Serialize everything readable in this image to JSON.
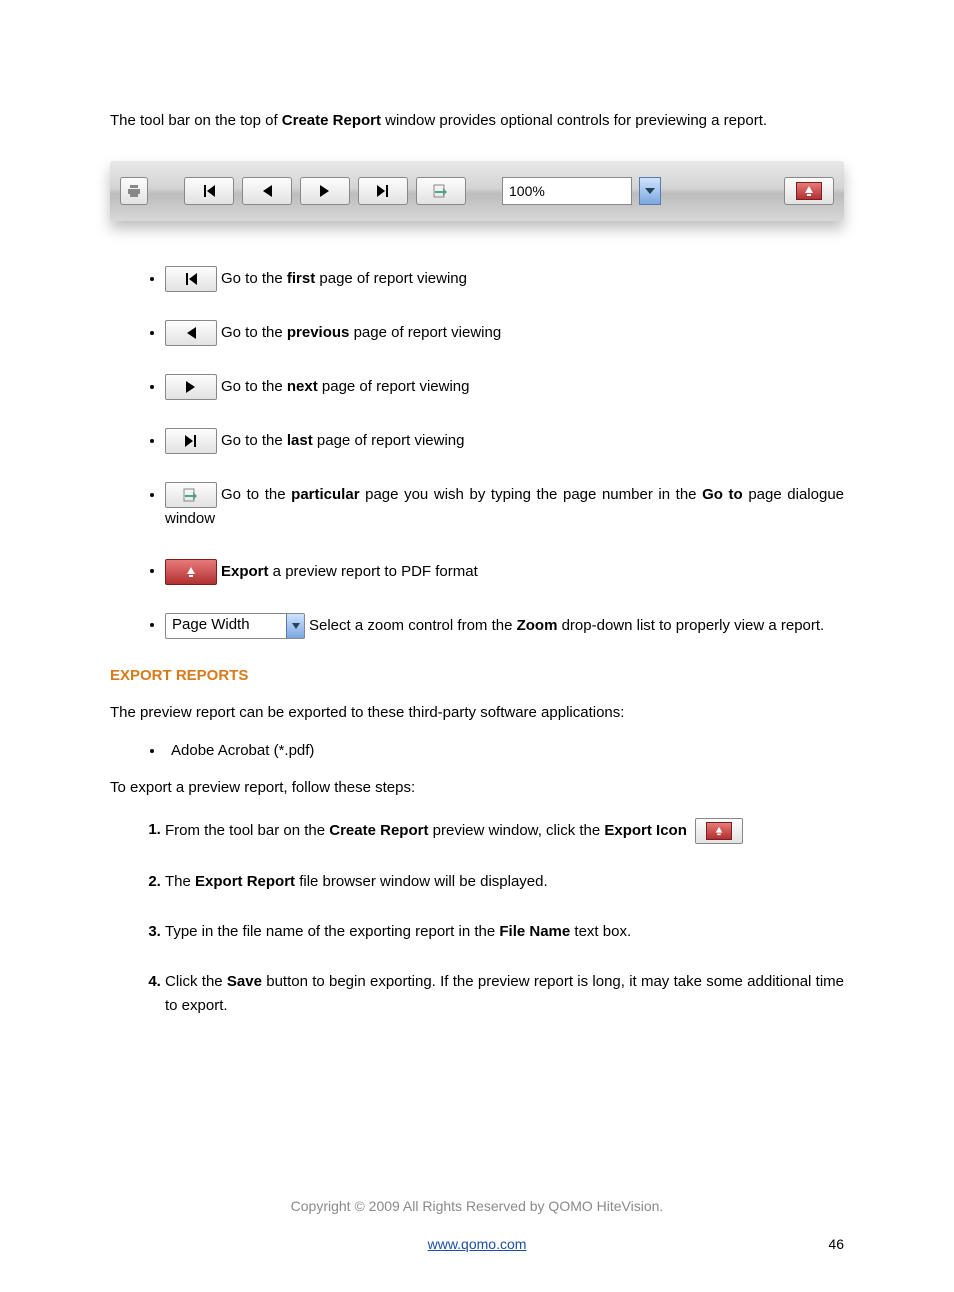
{
  "intro": {
    "pre": "The tool bar on the top of ",
    "bold": "Create Report",
    "post": " window provides optional controls for previewing a report."
  },
  "toolbar": {
    "zoom_value": "100%"
  },
  "bullets": {
    "first": {
      "a": "Go to the ",
      "b": "first",
      "c": " page of report viewing"
    },
    "prev": {
      "a": "Go to the ",
      "b": "previous",
      "c": " page of report viewing"
    },
    "next": {
      "a": "Go to the ",
      "b": "next",
      "c": " page of report viewing"
    },
    "last": {
      "a": "Go to the ",
      "b": "last",
      "c": " page of report viewing"
    },
    "goto": {
      "a": "Go to the ",
      "b": "particular",
      "c": " page you wish by typing the page number in the ",
      "d": "Go to",
      "e": " page dialogue window"
    },
    "export": {
      "b": "Export",
      "c": " a preview report to PDF format"
    },
    "zoom": {
      "label": "Page Width",
      "a": "Select a zoom control from the ",
      "b": "Zoom",
      "c": " drop-down list to properly view a report."
    }
  },
  "export_section": {
    "heading": "EXPORT REPORTS",
    "p1": "The preview report can be exported to these third-party software applications:",
    "list_item": "Adobe Acrobat (*.pdf)",
    "p2": "To export a preview report, follow these steps:",
    "steps": {
      "s1": {
        "a": "From the tool bar on the ",
        "b": "Create Report",
        "c": " preview window, click the ",
        "d": "Export Icon"
      },
      "s2": {
        "a": "The ",
        "b": "Export Report",
        "c": " file browser window will be displayed."
      },
      "s3": {
        "a": "Type in the file name of the exporting report in the ",
        "b": "File Name",
        "c": " text box."
      },
      "s4": {
        "a": "Click the ",
        "b": "Save",
        "c": " button to begin exporting. If the preview report is long, it may take some additional time to export."
      }
    }
  },
  "footer": {
    "copyright": "Copyright © 2009 All Rights Reserved by QOMO HiteVision.",
    "url": "www.qomo.com",
    "page": "46"
  }
}
